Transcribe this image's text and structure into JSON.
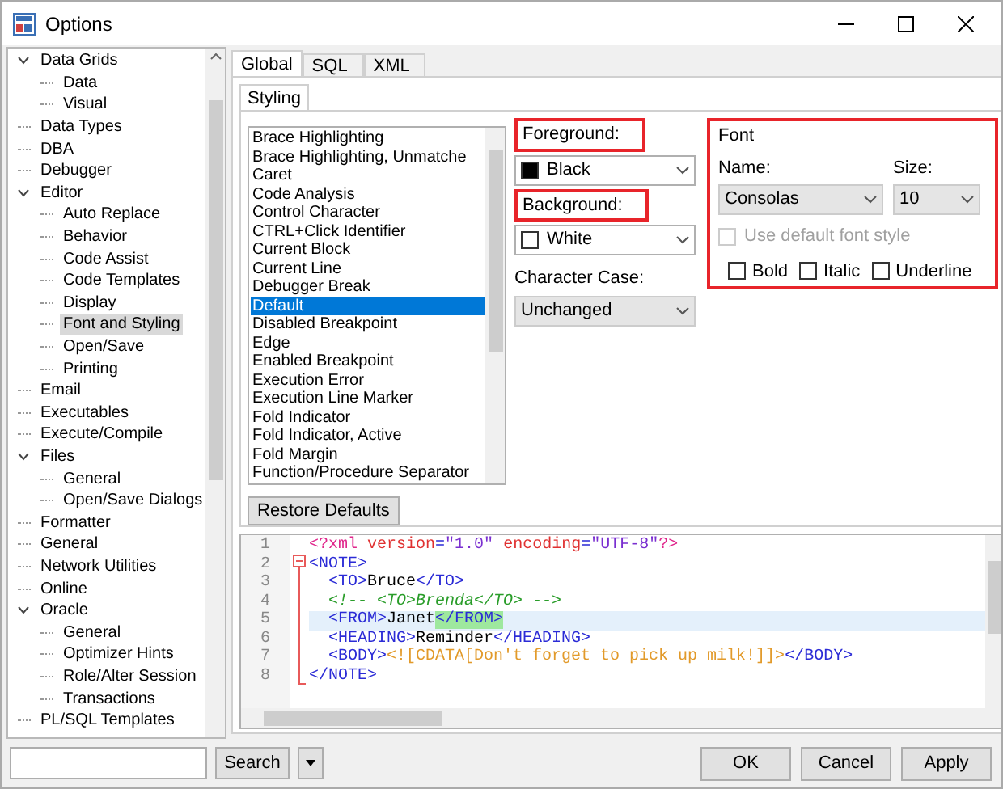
{
  "window": {
    "title": "Options"
  },
  "tree": [
    {
      "label": "Data Grids",
      "expanded": true,
      "selected": false,
      "children": [
        {
          "label": "Data",
          "selected": false
        },
        {
          "label": "Visual",
          "selected": false
        }
      ]
    },
    {
      "label": "Data Types",
      "selected": false
    },
    {
      "label": "DBA",
      "selected": false
    },
    {
      "label": "Debugger",
      "selected": false
    },
    {
      "label": "Editor",
      "expanded": true,
      "selected": false,
      "children": [
        {
          "label": "Auto Replace",
          "selected": false
        },
        {
          "label": "Behavior",
          "selected": false
        },
        {
          "label": "Code Assist",
          "selected": false
        },
        {
          "label": "Code Templates",
          "selected": false
        },
        {
          "label": "Display",
          "selected": false
        },
        {
          "label": "Font and Styling",
          "selected": true
        },
        {
          "label": "Open/Save",
          "selected": false
        },
        {
          "label": "Printing",
          "selected": false
        }
      ]
    },
    {
      "label": "Email",
      "selected": false
    },
    {
      "label": "Executables",
      "selected": false
    },
    {
      "label": "Execute/Compile",
      "selected": false
    },
    {
      "label": "Files",
      "expanded": true,
      "selected": false,
      "children": [
        {
          "label": "General",
          "selected": false
        },
        {
          "label": "Open/Save Dialogs",
          "selected": false
        }
      ]
    },
    {
      "label": "Formatter",
      "selected": false
    },
    {
      "label": "General",
      "selected": false
    },
    {
      "label": "Network Utilities",
      "selected": false
    },
    {
      "label": "Online",
      "selected": false
    },
    {
      "label": "Oracle",
      "expanded": true,
      "selected": false,
      "children": [
        {
          "label": "General",
          "selected": false
        },
        {
          "label": "Optimizer Hints",
          "selected": false
        },
        {
          "label": "Role/Alter Session",
          "selected": false
        },
        {
          "label": "Transactions",
          "selected": false
        }
      ]
    },
    {
      "label": "PL/SQL Templates",
      "selected": false
    }
  ],
  "tabs": [
    {
      "label": "Global",
      "selected": true
    },
    {
      "label": "SQL",
      "selected": false
    },
    {
      "label": "XML",
      "selected": false
    }
  ],
  "subtabs": [
    {
      "label": "Styling",
      "selected": true
    }
  ],
  "elements": [
    {
      "label": "Brace Highlighting",
      "selected": false
    },
    {
      "label": "Brace Highlighting, Unmatche",
      "selected": false
    },
    {
      "label": "Caret",
      "selected": false
    },
    {
      "label": "Code Analysis",
      "selected": false
    },
    {
      "label": "Control Character",
      "selected": false
    },
    {
      "label": "CTRL+Click Identifier",
      "selected": false
    },
    {
      "label": "Current Block",
      "selected": false
    },
    {
      "label": "Current Line",
      "selected": false
    },
    {
      "label": "Debugger Break",
      "selected": false
    },
    {
      "label": "Default",
      "selected": true
    },
    {
      "label": "Disabled Breakpoint",
      "selected": false
    },
    {
      "label": "Edge",
      "selected": false
    },
    {
      "label": "Enabled Breakpoint",
      "selected": false
    },
    {
      "label": "Execution Error",
      "selected": false
    },
    {
      "label": "Execution Line Marker",
      "selected": false
    },
    {
      "label": "Fold Indicator",
      "selected": false
    },
    {
      "label": "Fold Indicator, Active",
      "selected": false
    },
    {
      "label": "Fold Margin",
      "selected": false
    },
    {
      "label": "Function/Procedure Separator",
      "selected": false
    }
  ],
  "restore_button": "Restore Defaults",
  "foreground": {
    "label": "Foreground:",
    "highlighted": true,
    "value": "Black",
    "color": "#000000"
  },
  "background": {
    "label": "Background:",
    "highlighted": true,
    "value": "White",
    "color": "#ffffff"
  },
  "character_case": {
    "label": "Character Case:",
    "value": "Unchanged"
  },
  "font": {
    "title": "Font",
    "highlighted": true,
    "name_label": "Name:",
    "name": "Consolas",
    "size_label": "Size:",
    "size": "10",
    "use_default": {
      "label": "Use default font style",
      "checked": false,
      "disabled": true
    },
    "styles": [
      {
        "label": "Bold",
        "checked": false
      },
      {
        "label": "Italic",
        "checked": false
      },
      {
        "label": "Underline",
        "checked": false
      }
    ]
  },
  "preview": {
    "lines": [
      {
        "number": "1",
        "current": false,
        "indented": false,
        "tokens": [
          {
            "kind": "pi",
            "text": "<?xml "
          },
          {
            "kind": "attr",
            "text": "version"
          },
          {
            "kind": "tag",
            "text": "="
          },
          {
            "kind": "value",
            "text": "\"1.0\" "
          },
          {
            "kind": "attr",
            "text": "encoding"
          },
          {
            "kind": "tag",
            "text": "="
          },
          {
            "kind": "value",
            "text": "\"UTF-8\""
          },
          {
            "kind": "pi",
            "text": "?>"
          }
        ]
      },
      {
        "number": "2",
        "current": false,
        "indented": false,
        "tokens": [
          {
            "kind": "tag",
            "text": "<NOTE>"
          }
        ]
      },
      {
        "number": "3",
        "current": false,
        "indented": true,
        "tokens": [
          {
            "kind": "tag",
            "text": "<TO>"
          },
          {
            "kind": "text",
            "text": "Bruce"
          },
          {
            "kind": "tag",
            "text": "</TO>"
          }
        ]
      },
      {
        "number": "4",
        "current": false,
        "indented": true,
        "tokens": [
          {
            "kind": "comment",
            "text": "<!-- <TO>Brenda</TO> -->"
          }
        ]
      },
      {
        "number": "5",
        "current": true,
        "indented": true,
        "tokens": [
          {
            "kind": "tag",
            "text": "<FROM>"
          },
          {
            "kind": "text",
            "text": "Janet"
          },
          {
            "kind": "match",
            "text": "</FROM>"
          }
        ]
      },
      {
        "number": "6",
        "current": false,
        "indented": true,
        "tokens": [
          {
            "kind": "tag",
            "text": "<HEADING>"
          },
          {
            "kind": "text",
            "text": "Reminder"
          },
          {
            "kind": "tag",
            "text": "</HEADING>"
          }
        ]
      },
      {
        "number": "7",
        "current": false,
        "indented": true,
        "tokens": [
          {
            "kind": "tag",
            "text": "<BODY>"
          },
          {
            "kind": "cdata",
            "text": "<![CDATA[Don't forget to pick up milk!]]>"
          },
          {
            "kind": "tag",
            "text": "</BODY>"
          }
        ]
      },
      {
        "number": "8",
        "current": false,
        "indented": false,
        "tokens": [
          {
            "kind": "tag",
            "text": "</NOTE>"
          }
        ]
      }
    ]
  },
  "search_button": "Search",
  "buttons": [
    "OK",
    "Cancel",
    "Apply"
  ]
}
